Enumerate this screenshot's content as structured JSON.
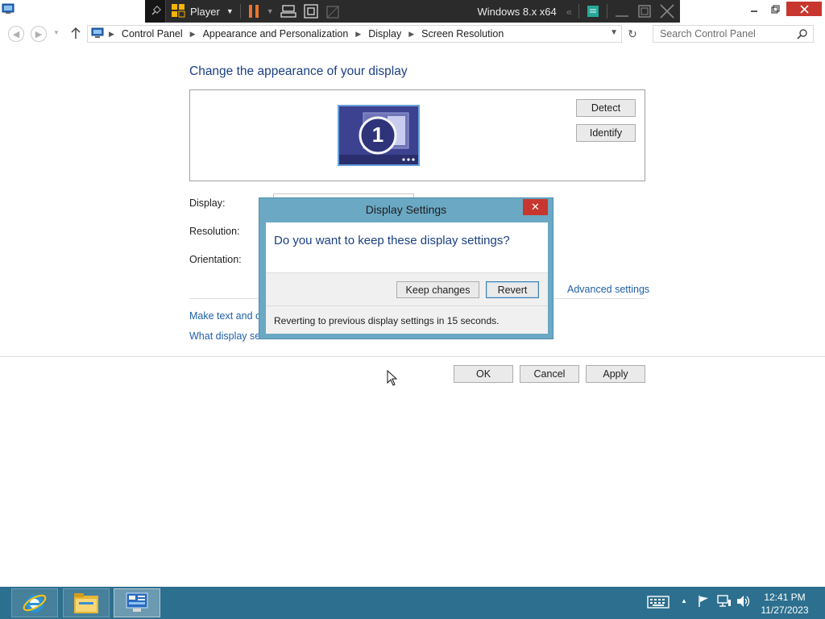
{
  "vm_toolbar": {
    "player_label": "Player",
    "vm_title": "Windows 8.x x64"
  },
  "address_bar": {
    "breadcrumbs": [
      "Control Panel",
      "Appearance and Personalization",
      "Display",
      "Screen Resolution"
    ],
    "search_placeholder": "Search Control Panel"
  },
  "main": {
    "heading": "Change the appearance of your display",
    "detect_label": "Detect",
    "identify_label": "Identify",
    "monitor_number": "1",
    "display_label": "Display:",
    "resolution_label": "Resolution:",
    "orientation_label": "Orientation:",
    "advanced_link": "Advanced settings",
    "link_text_size": "Make text and ot",
    "link_what_settings": "What display setti",
    "ok_label": "OK",
    "cancel_label": "Cancel",
    "apply_label": "Apply"
  },
  "dialog": {
    "title": "Display Settings",
    "question": "Do you want to keep these display settings?",
    "keep_label": "Keep changes",
    "revert_label": "Revert",
    "countdown_text": "Reverting to previous display settings in 15 seconds."
  },
  "taskbar": {
    "time": "12:41 PM",
    "date": "11/27/2023"
  },
  "colors": {
    "taskbar": "#2d6f8e",
    "dialog_frame": "#6aa8c4",
    "link": "#1f5fa8",
    "heading": "#1c3f82",
    "close_red": "#c7372f"
  }
}
